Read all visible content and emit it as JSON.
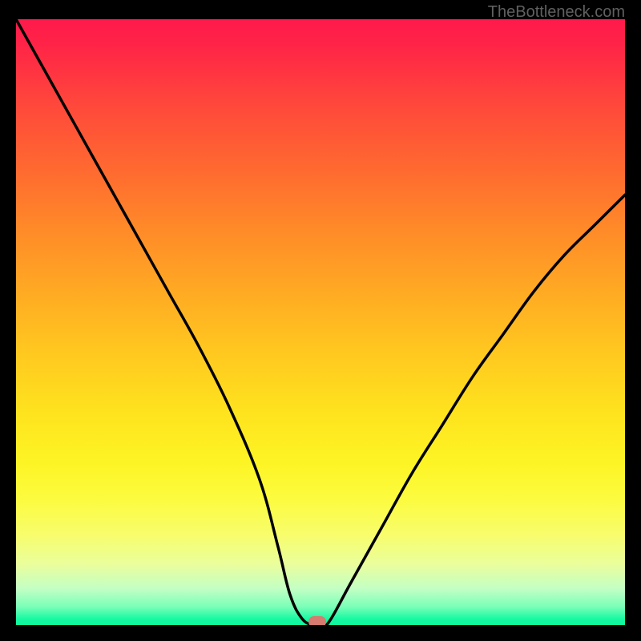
{
  "watermark": "TheBottleneck.com",
  "chart_data": {
    "type": "line",
    "title": "",
    "xlabel": "",
    "ylabel": "",
    "xlim": [
      0,
      100
    ],
    "ylim": [
      0,
      100
    ],
    "series": [
      {
        "name": "curve",
        "x": [
          0,
          5,
          10,
          15,
          20,
          25,
          30,
          35,
          40,
          43,
          45,
          47,
          49,
          51,
          55,
          60,
          65,
          70,
          75,
          80,
          85,
          90,
          95,
          100
        ],
        "y": [
          100,
          91,
          82,
          73,
          64,
          55,
          46,
          36,
          24,
          13,
          5,
          1,
          0,
          0,
          7,
          16,
          25,
          33,
          41,
          48,
          55,
          61,
          66,
          71
        ]
      }
    ],
    "marker": {
      "x": 49.5,
      "y": 0
    },
    "gradient_stops": [
      {
        "pos": 0,
        "color": "#ff1a4c"
      },
      {
        "pos": 50,
        "color": "#ffc81f"
      },
      {
        "pos": 80,
        "color": "#fcfb3e"
      },
      {
        "pos": 100,
        "color": "#0ef79e"
      }
    ]
  }
}
